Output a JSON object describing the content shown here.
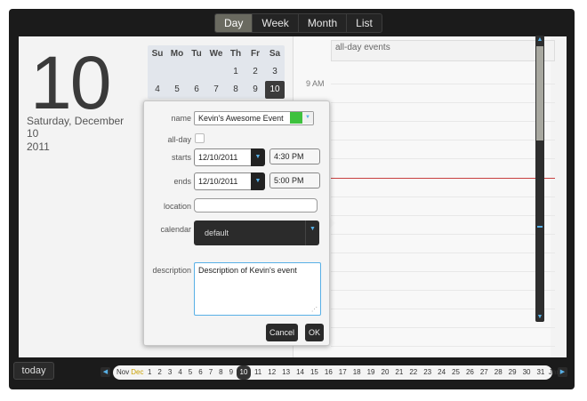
{
  "view_tabs": [
    {
      "label": "Day",
      "active": true
    },
    {
      "label": "Week",
      "active": false
    },
    {
      "label": "Month",
      "active": false
    },
    {
      "label": "List",
      "active": false
    }
  ],
  "day_header": {
    "number": "10",
    "line1": "Saturday, December",
    "line2": "10",
    "line3": "2011"
  },
  "mini_calendar": {
    "weekdays": [
      "Su",
      "Mo",
      "Tu",
      "We",
      "Th",
      "Fr",
      "Sa"
    ],
    "row1": [
      "",
      "",
      "",
      "",
      "1",
      "2",
      "3"
    ],
    "row2": [
      "4",
      "5",
      "6",
      "7",
      "8",
      "9",
      "10"
    ],
    "selected": "10"
  },
  "grid": {
    "allday_label": "all-day events",
    "hour_label": "9 AM"
  },
  "event_form": {
    "name_label": "name",
    "name_value": "Kevin's Awesome Event",
    "color": "#3ec13e",
    "allday_label": "all-day",
    "starts_label": "starts",
    "starts_date": "12/10/2011",
    "starts_time": "4:30 PM",
    "ends_label": "ends",
    "ends_date": "12/10/2011",
    "ends_time": "5:00 PM",
    "location_label": "location",
    "location_value": "",
    "calendar_label": "calendar",
    "calendar_value": "default",
    "description_label": "description",
    "description_value": "Description of Kevin's event",
    "cancel_label": "Cancel",
    "ok_label": "OK"
  },
  "footer": {
    "today_label": "today",
    "month_prev": "Nov",
    "month_cur": "Dec",
    "month_next": "Jan",
    "days": [
      "1",
      "2",
      "3",
      "4",
      "5",
      "6",
      "7",
      "8",
      "9",
      "10",
      "11",
      "12",
      "13",
      "14",
      "15",
      "16",
      "17",
      "18",
      "19",
      "20",
      "21",
      "22",
      "23",
      "24",
      "25",
      "26",
      "27",
      "28",
      "29",
      "30",
      "31"
    ],
    "selected_day": "10"
  },
  "colors": {
    "accent": "#58b0e6",
    "now_line": "#c84040",
    "frame": "#1b1b1b"
  }
}
